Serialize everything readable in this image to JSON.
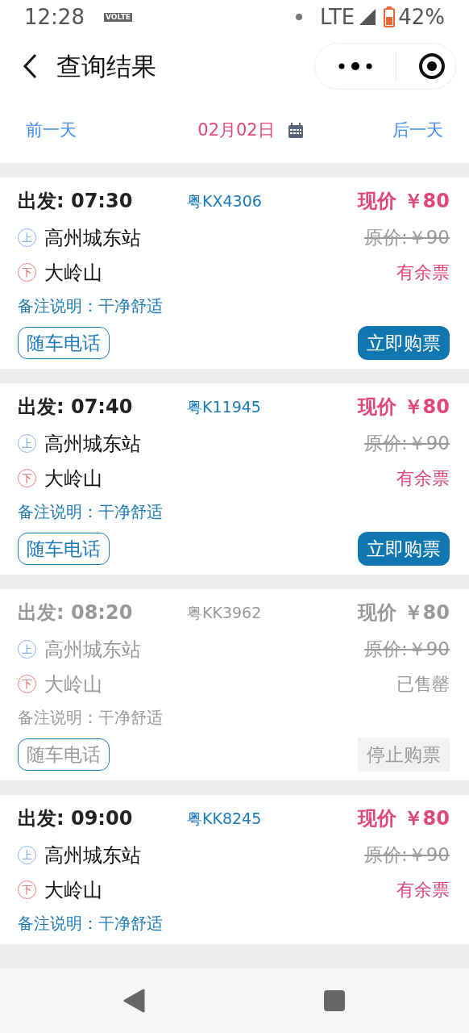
{
  "status_bar": {
    "time": "12:28",
    "volte": "VOLTE",
    "network": "LTE",
    "battery": "42%"
  },
  "header": {
    "title": "查询结果"
  },
  "date_nav": {
    "prev": "前一天",
    "date": "02月02日",
    "next": "后一天"
  },
  "trips": [
    {
      "departure": "出发: 07:30",
      "plate": "粤KX4306",
      "price": "现价 ￥80",
      "from_mark": "上",
      "from": "高州城东站",
      "original_price": "原价:￥90",
      "to_mark": "下",
      "to": "大岭山",
      "status": "有余票",
      "remark": "备注说明：干净舒适",
      "sold_out": false,
      "buttons": [
        {
          "kind": "call",
          "label": "随车电话",
          "disabled": false
        },
        {
          "kind": "buy",
          "label": "立即购票",
          "disabled": false
        }
      ]
    },
    {
      "departure": "出发: 07:40",
      "plate": "粤K11945",
      "price": "现价 ￥80",
      "from_mark": "上",
      "from": "高州城东站",
      "original_price": "原价:￥90",
      "to_mark": "下",
      "to": "大岭山",
      "status": "有余票",
      "remark": "备注说明：干净舒适",
      "sold_out": false,
      "buttons": [
        {
          "kind": "call",
          "label": "随车电话",
          "disabled": false
        },
        {
          "kind": "buy",
          "label": "立即购票",
          "disabled": false
        }
      ]
    },
    {
      "departure": "出发: 08:20",
      "plate": "粤KK3962",
      "price": "现价 ￥80",
      "from_mark": "上",
      "from": "高州城东站",
      "original_price": "原价:￥90",
      "to_mark": "下",
      "to": "大岭山",
      "status": "已售罄",
      "remark": "备注说明：干净舒适",
      "sold_out": true,
      "buttons": [
        {
          "kind": "call",
          "label": "随车电话",
          "disabled": false
        },
        {
          "kind": "buy",
          "label": "停止购票",
          "disabled": true
        }
      ]
    },
    {
      "departure": "出发: 09:00",
      "plate": "粤KK8245",
      "price": "现价 ￥80",
      "from_mark": "上",
      "from": "高州城东站",
      "original_price": "原价:￥90",
      "to_mark": "下",
      "to": "大岭山",
      "status": "有余票",
      "remark": "备注说明：干净舒适",
      "sold_out": false
    }
  ]
}
